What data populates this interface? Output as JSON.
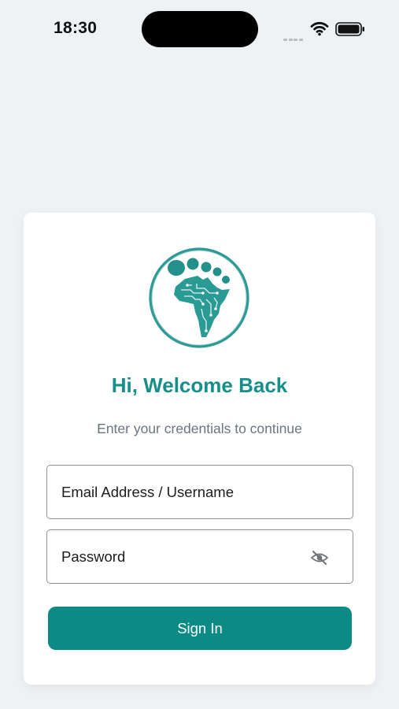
{
  "status_bar": {
    "time": "18:30",
    "icons": [
      "signal-dots-icon",
      "wifi-icon",
      "battery-icon"
    ]
  },
  "login": {
    "logo_icon": "africa-footprint-logo",
    "title": "Hi, Welcome Back",
    "subtitle": "Enter your credentials to continue",
    "email_placeholder": "Email Address / Username",
    "email_value": "",
    "password_placeholder": "Password",
    "password_value": "",
    "password_toggle_icon": "eye-off-icon",
    "signin_label": "Sign In"
  },
  "colors": {
    "background": "#eef2f5",
    "card": "#ffffff",
    "accent": "#0c8a86",
    "title": "#168f8a",
    "subtitle": "#6b7480",
    "field_border": "#8e9196"
  }
}
